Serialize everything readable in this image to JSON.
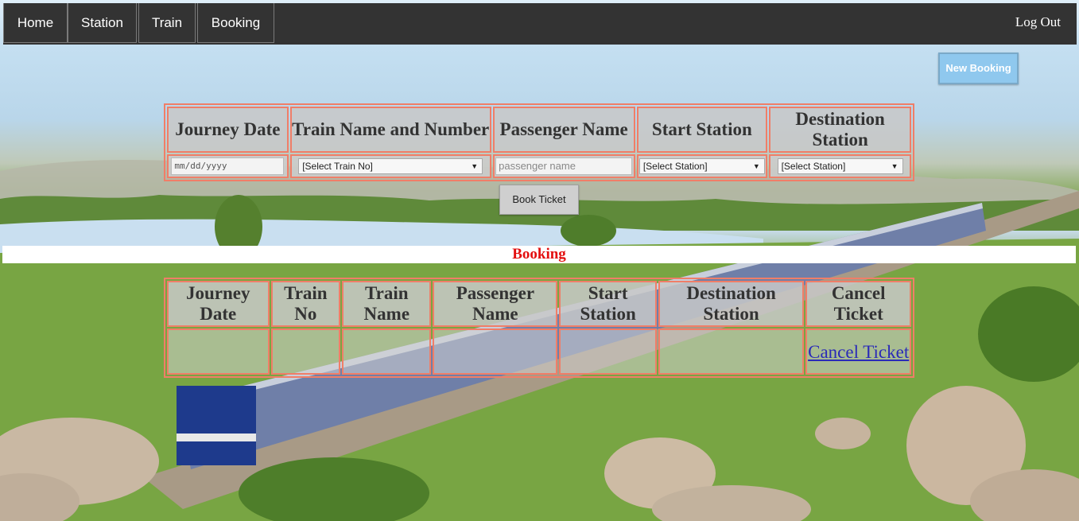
{
  "nav": {
    "items": [
      {
        "label": "Home"
      },
      {
        "label": "Station"
      },
      {
        "label": "Train"
      },
      {
        "label": "Booking"
      }
    ],
    "logout_label": "Log Out"
  },
  "new_booking_label": "New Booking",
  "form": {
    "headers": [
      "Journey Date",
      "Train Name and Number",
      "Passenger Name",
      "Start Station",
      "Destination Station"
    ],
    "date_placeholder": "mm/dd/yyyy",
    "train_select": "[Select Train No]",
    "passenger_placeholder": "passenger name",
    "start_select": "[Select Station]",
    "destination_select": "[Select Station]",
    "book_label": "Book Ticket"
  },
  "banner_title": "Booking",
  "list": {
    "headers": [
      "Journey Date",
      "Train No",
      "Train Name",
      "Passenger Name",
      "Start Station",
      "Destination Station",
      "Cancel Ticket"
    ],
    "cancel_link": "Cancel Ticket"
  }
}
